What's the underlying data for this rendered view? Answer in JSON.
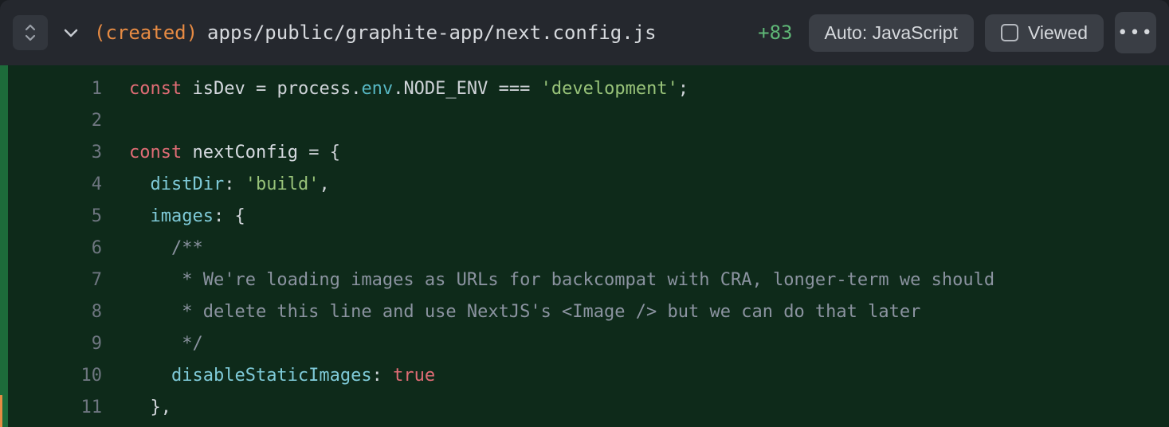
{
  "header": {
    "file_status": "(created)",
    "file_path": "apps/public/graphite-app/next.config.js",
    "diff_stat": "+83",
    "language_pill": "Auto: JavaScript",
    "viewed_label": "Viewed"
  },
  "code": {
    "lines": [
      {
        "n": "1",
        "tokens": [
          {
            "t": "const",
            "c": "tok-keyword"
          },
          {
            "t": " ",
            "c": ""
          },
          {
            "t": "isDev",
            "c": "tok-var"
          },
          {
            "t": " ",
            "c": ""
          },
          {
            "t": "=",
            "c": "tok-op"
          },
          {
            "t": " ",
            "c": ""
          },
          {
            "t": "process",
            "c": "tok-ident"
          },
          {
            "t": ".",
            "c": "tok-punc"
          },
          {
            "t": "env",
            "c": "tok-env"
          },
          {
            "t": ".",
            "c": "tok-punc"
          },
          {
            "t": "NODE_ENV",
            "c": "tok-ident"
          },
          {
            "t": " ",
            "c": ""
          },
          {
            "t": "===",
            "c": "tok-op"
          },
          {
            "t": " ",
            "c": ""
          },
          {
            "t": "'development'",
            "c": "tok-string"
          },
          {
            "t": ";",
            "c": "tok-punc"
          }
        ]
      },
      {
        "n": "2",
        "tokens": []
      },
      {
        "n": "3",
        "tokens": [
          {
            "t": "const",
            "c": "tok-keyword"
          },
          {
            "t": " ",
            "c": ""
          },
          {
            "t": "nextConfig",
            "c": "tok-var"
          },
          {
            "t": " ",
            "c": ""
          },
          {
            "t": "=",
            "c": "tok-op"
          },
          {
            "t": " ",
            "c": ""
          },
          {
            "t": "{",
            "c": "tok-punc"
          }
        ]
      },
      {
        "n": "4",
        "tokens": [
          {
            "t": "  ",
            "c": ""
          },
          {
            "t": "distDir",
            "c": "tok-propkey"
          },
          {
            "t": ":",
            "c": "tok-punc"
          },
          {
            "t": " ",
            "c": ""
          },
          {
            "t": "'build'",
            "c": "tok-string"
          },
          {
            "t": ",",
            "c": "tok-punc"
          }
        ]
      },
      {
        "n": "5",
        "tokens": [
          {
            "t": "  ",
            "c": ""
          },
          {
            "t": "images",
            "c": "tok-propkey"
          },
          {
            "t": ":",
            "c": "tok-punc"
          },
          {
            "t": " ",
            "c": ""
          },
          {
            "t": "{",
            "c": "tok-punc"
          }
        ]
      },
      {
        "n": "6",
        "tokens": [
          {
            "t": "    ",
            "c": ""
          },
          {
            "t": "/**",
            "c": "tok-comment"
          }
        ]
      },
      {
        "n": "7",
        "tokens": [
          {
            "t": "    ",
            "c": ""
          },
          {
            "t": " * We're loading images as URLs for backcompat with CRA, longer-term we should",
            "c": "tok-comment"
          }
        ]
      },
      {
        "n": "8",
        "tokens": [
          {
            "t": "    ",
            "c": ""
          },
          {
            "t": " * delete this line and use NextJS's <Image /> but we can do that later",
            "c": "tok-comment"
          }
        ]
      },
      {
        "n": "9",
        "tokens": [
          {
            "t": "    ",
            "c": ""
          },
          {
            "t": " */",
            "c": "tok-comment"
          }
        ]
      },
      {
        "n": "10",
        "tokens": [
          {
            "t": "    ",
            "c": ""
          },
          {
            "t": "disableStaticImages",
            "c": "tok-propkey"
          },
          {
            "t": ":",
            "c": "tok-punc"
          },
          {
            "t": " ",
            "c": ""
          },
          {
            "t": "true",
            "c": "tok-bool"
          }
        ]
      },
      {
        "n": "11",
        "tokens": [
          {
            "t": "  ",
            "c": ""
          },
          {
            "t": "},",
            "c": "tok-punc"
          }
        ]
      }
    ]
  }
}
